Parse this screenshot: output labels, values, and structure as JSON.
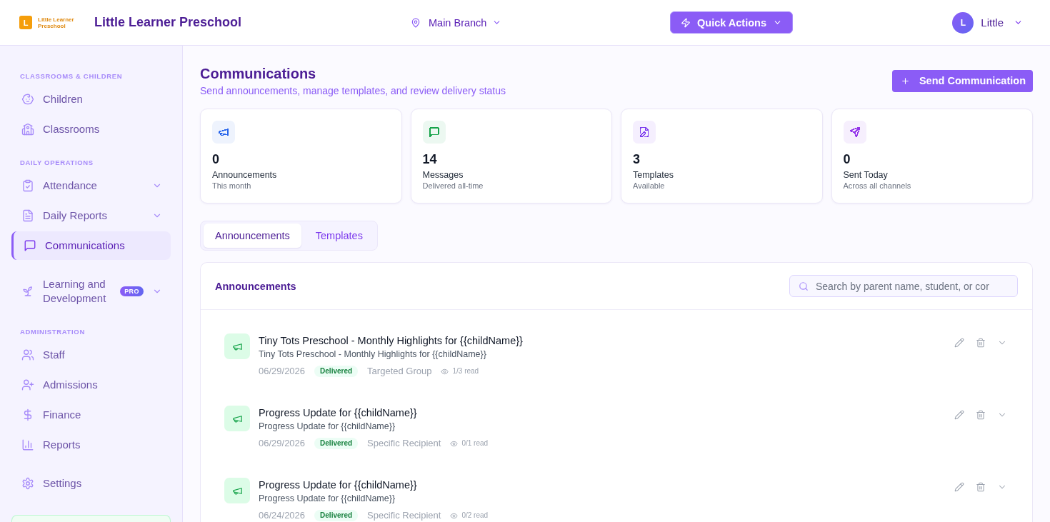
{
  "header": {
    "logo_mark": "L",
    "logo_text": "Little Learner Preschool",
    "title": "Little Learner Preschool",
    "branch": "Main Branch",
    "quick_actions": "Quick Actions",
    "user": {
      "initial": "L",
      "name": "Little"
    }
  },
  "sidebar": {
    "sections": [
      {
        "heading": "CLASSROOMS & CHILDREN",
        "items": [
          {
            "label": "Children",
            "kind": "link",
            "selected": false
          },
          {
            "label": "Classrooms",
            "kind": "link",
            "selected": false
          }
        ]
      },
      {
        "heading": "DAILY OPERATIONS",
        "items": [
          {
            "label": "Attendance",
            "kind": "group",
            "selected": false
          },
          {
            "label": "Daily Reports",
            "kind": "group",
            "selected": false
          },
          {
            "label": "Communications",
            "kind": "link",
            "selected": true
          }
        ]
      },
      {
        "items": [
          {
            "label": "Learning and Development",
            "kind": "group",
            "selected": false,
            "badge": "PRO"
          }
        ]
      },
      {
        "heading": "ADMINISTRATION",
        "items": [
          {
            "label": "Staff",
            "kind": "link",
            "selected": false
          },
          {
            "label": "Admissions",
            "kind": "link",
            "selected": false
          },
          {
            "label": "Finance",
            "kind": "link",
            "selected": false
          },
          {
            "label": "Reports",
            "kind": "link",
            "selected": false
          }
        ]
      },
      {
        "items": [
          {
            "label": "Settings",
            "kind": "link",
            "selected": false
          }
        ]
      }
    ]
  },
  "page": {
    "title": "Communications",
    "subtitle": "Send announcements, manage templates, and review delivery status",
    "action": "Send Communication"
  },
  "stats": [
    {
      "value": "0",
      "label": "Announcements",
      "note": "This month",
      "color": "#2563eb"
    },
    {
      "value": "14",
      "label": "Messages",
      "note": "Delivered all-time",
      "color": "#16a34a"
    },
    {
      "value": "3",
      "label": "Templates",
      "note": "Available",
      "color": "#7c3aed"
    },
    {
      "value": "0",
      "label": "Sent Today",
      "note": "Across all channels",
      "color": "#9333ea"
    }
  ],
  "tabs": [
    {
      "label": "Announcements",
      "selected": true
    },
    {
      "label": "Templates",
      "selected": false
    }
  ],
  "announcements": {
    "title": "Announcements",
    "search": {
      "placeholder": "Search by parent name, student, or cor"
    },
    "items": [
      {
        "title": "Tiny Tots Preschool - Monthly Highlights for {{childName}}",
        "preview": "Tiny Tots Preschool - Monthly Highlights for {{childName}}",
        "date": "06/29/2026",
        "status": "Delivered",
        "audience": "Targeted Group",
        "reads": "1/3 read"
      },
      {
        "title": "Progress Update for {{childName}}",
        "preview": "Progress Update for {{childName}}",
        "date": "06/29/2026",
        "status": "Delivered",
        "audience": "Specific Recipient",
        "reads": "0/1 read"
      },
      {
        "title": "Progress Update for {{childName}}",
        "preview": "Progress Update for {{childName}}",
        "date": "06/24/2026",
        "status": "Delivered",
        "audience": "Specific Recipient",
        "reads": "0/2 read"
      }
    ]
  }
}
